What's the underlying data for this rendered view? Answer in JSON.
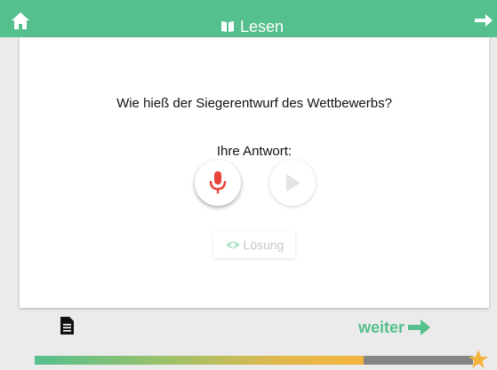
{
  "header": {
    "title": "Lesen",
    "home_icon": "home-icon",
    "book_icon": "book-open-icon",
    "next_icon": "arrow-right-icon",
    "bg_color": "#56bf8e"
  },
  "card": {
    "question": "Wie hieß der Siegerentwurf des Wettbewerbs?",
    "answer_label": "Ihre Antwort:",
    "mic_icon": "microphone-icon",
    "play_icon": "play-icon",
    "solution": {
      "label": "Lösung",
      "icon": "eye-icon"
    }
  },
  "footer": {
    "document_icon": "document-icon",
    "next_label": "weiter",
    "next_icon": "arrow-right-icon",
    "progress_fraction": 0.75,
    "goal_icon": "star-icon"
  },
  "colors": {
    "accent": "#56bf8e",
    "mic": "#e8423a",
    "star": "#f3b43d"
  }
}
